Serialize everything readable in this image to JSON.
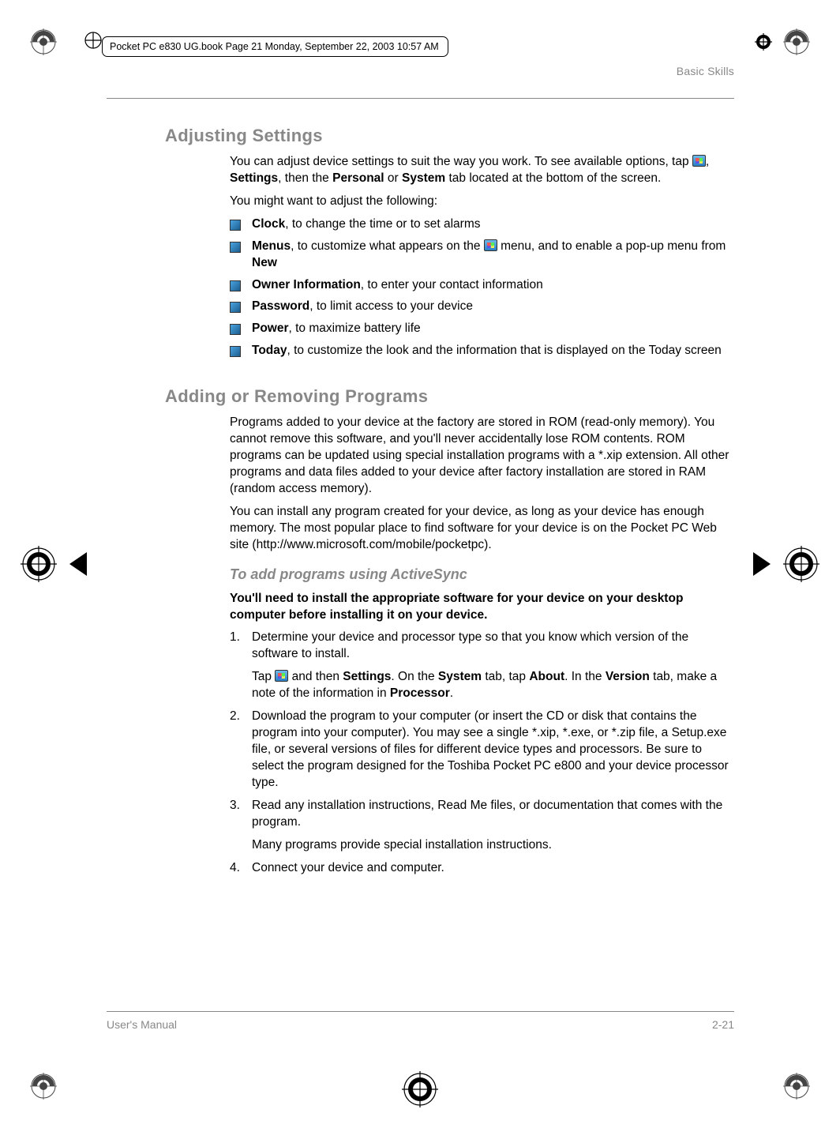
{
  "meta": {
    "frame_text": "Pocket PC e830 UG.book  Page 21  Monday, September 22, 2003  10:57 AM"
  },
  "header": {
    "section": "Basic Skills"
  },
  "sections": {
    "adjusting": {
      "title": "Adjusting Settings",
      "intro_before_icon": "You can adjust device settings to suit the way you work. To see available options, tap ",
      "intro_after_icon": ", ",
      "intro_bold1": "Settings",
      "intro_mid": ", then the ",
      "intro_bold2": "Personal",
      "intro_or": " or ",
      "intro_bold3": "System",
      "intro_end": " tab located at the bottom of the screen.",
      "para2": "You might want to adjust the following:",
      "items": {
        "clock_b": "Clock",
        "clock_t": ", to change the time or to set alarms",
        "menus_b": "Menus",
        "menus_t1": ", to customize what appears on the ",
        "menus_t2": " menu, and to enable a pop-up menu from ",
        "menus_b2": "New",
        "owner_b": "Owner Information",
        "owner_t": ", to enter your contact information",
        "password_b": "Password",
        "password_t": ", to limit access to your device",
        "power_b": "Power",
        "power_t": ", to maximize battery life",
        "today_b": "Today",
        "today_t": ", to customize the look and the information that is displayed on the Today screen"
      }
    },
    "adding": {
      "title": "Adding or Removing Programs",
      "para1": "Programs added to your device at the factory are stored in ROM (read-only memory). You cannot remove this software, and you'll never accidentally lose ROM contents. ROM programs can be updated using special installation programs with a *.xip extension. All other programs and data files added to your device after factory installation are stored in RAM (random access memory).",
      "para2": "You can install any program created for your device, as long as your device has enough memory. The most popular place to find software for your device is on the Pocket PC Web site (http://www.microsoft.com/mobile/pocketpc)."
    },
    "activesync": {
      "title": "To add programs using ActiveSync",
      "lead": "You'll need to install the appropriate software for your device on your desktop computer before installing it on your device.",
      "steps": {
        "s1": "Determine your device and processor type so that you know which version of the software to install.",
        "s1b_pre": "Tap ",
        "s1b_mid1": " and then ",
        "s1b_b1": "Settings",
        "s1b_mid2": ". On the ",
        "s1b_b2": "System",
        "s1b_mid3": " tab, tap ",
        "s1b_b3": "About",
        "s1b_mid4": ". In the ",
        "s1b_b4": "Version",
        "s1b_mid5": " tab, make a note of the information in ",
        "s1b_b5": "Processor",
        "s1b_end": ".",
        "s2": "Download the program to your computer (or insert the CD or disk that contains the program into your computer). You may see a single *.xip, *.exe, or *.zip file, a Setup.exe file, or several versions of files for different device types and processors. Be sure to select the program designed for the Toshiba Pocket PC e800 and your device processor type.",
        "s3": "Read any installation instructions, Read Me files, or documentation that comes with the program.",
        "s3b": "Many programs provide special installation instructions.",
        "s4": "Connect your device and computer."
      }
    }
  },
  "footer": {
    "left": "User's Manual",
    "right": "2-21"
  }
}
